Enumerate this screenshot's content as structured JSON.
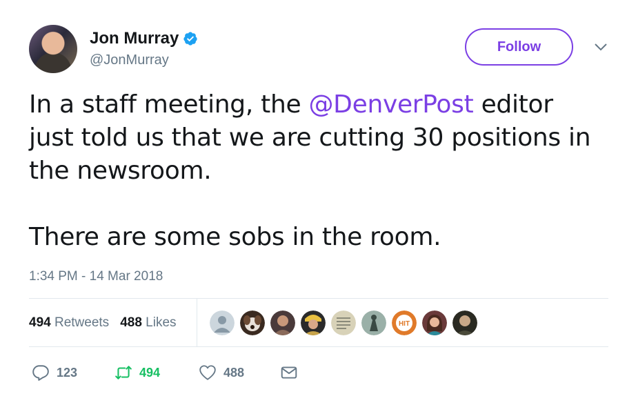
{
  "author": {
    "name": "Jon Murray",
    "handle": "@JonMurray",
    "verified": true
  },
  "follow_button": {
    "label": "Follow",
    "color": "#7b3fe4"
  },
  "tweet": {
    "text_before": "In a staff meeting, the ",
    "mention": "@DenverPost",
    "text_after": " editor\njust told us that we are cutting 30 positions in\nthe newsroom.\n\nThere are some sobs in the room.",
    "timestamp": "1:34 PM - 14 Mar 2018"
  },
  "stats": {
    "retweets_count": "494",
    "retweets_label": "Retweets",
    "likes_count": "488",
    "likes_label": "Likes"
  },
  "liker_avatars": [
    {
      "icon": "default-avatar-icon",
      "color": "#ccd6dd"
    },
    {
      "icon": "dog-avatar-icon",
      "color": "#6b4a34"
    },
    {
      "icon": "person-avatar-icon",
      "color": "#8a6a5a"
    },
    {
      "icon": "person-avatar-icon",
      "color": "#c8a44a"
    },
    {
      "icon": "document-avatar-icon",
      "color": "#d8d2b8"
    },
    {
      "icon": "statue-avatar-icon",
      "color": "#5a7a6a"
    },
    {
      "icon": "hit-logo-avatar-icon",
      "color": "#e07a2a",
      "text": "HIT"
    },
    {
      "icon": "person-avatar-icon",
      "color": "#9a6a5a"
    },
    {
      "icon": "person-avatar-icon",
      "color": "#4a4a3a"
    }
  ],
  "actions": {
    "reply_count": "123",
    "retweet_count": "494",
    "like_count": "488",
    "retweet_color": "#17bf63",
    "icons": [
      "reply-icon",
      "retweet-icon",
      "heart-icon",
      "message-icon"
    ]
  }
}
